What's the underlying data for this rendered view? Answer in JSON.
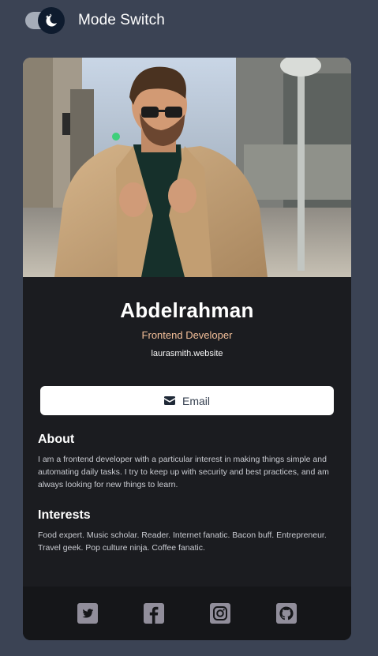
{
  "header": {
    "mode_label": "Mode Switch",
    "toggle_icon": "moon-stars-icon"
  },
  "profile": {
    "photo_icon": "profile-photo",
    "name": "Abdelrahman",
    "role": "Frontend Developer",
    "website": "laurasmith.website"
  },
  "actions": {
    "email_label": "Email",
    "email_icon": "envelope-icon"
  },
  "about": {
    "heading": "About",
    "text": "I am a frontend developer with a particular interest in making things simple and automating daily tasks. I try to keep up with security and best practices, and am always looking for new things to learn."
  },
  "interests": {
    "heading": "Interests",
    "text": "Food expert. Music scholar. Reader. Internet fanatic. Bacon buff. Entrepreneur. Travel geek. Pop culture ninja. Coffee fanatic."
  },
  "footer": {
    "icons": [
      "twitter-icon",
      "facebook-icon",
      "instagram-icon",
      "github-icon"
    ]
  },
  "colors": {
    "page_bg": "#3b4354",
    "card_bg": "#1b1c20",
    "footer_bg": "#151619",
    "accent": "#f3bf99",
    "social_icon": "#918e9b"
  }
}
